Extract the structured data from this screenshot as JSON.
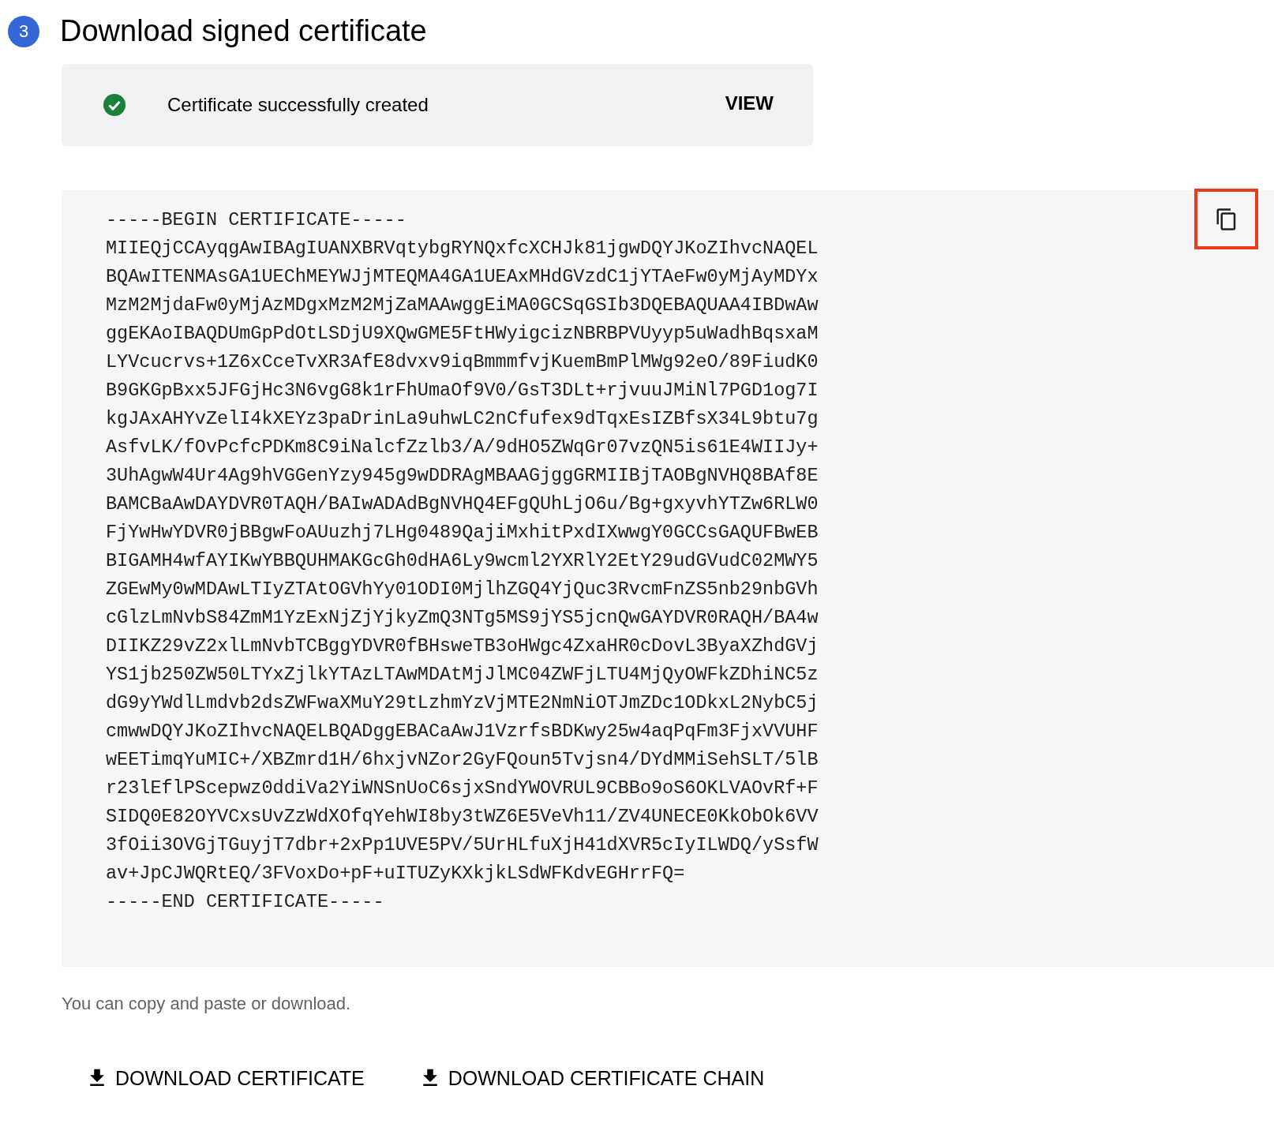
{
  "step": {
    "number": "3",
    "title": "Download signed certificate"
  },
  "banner": {
    "message": "Certificate successfully created",
    "action": "VIEW"
  },
  "certificate": {
    "copy_button": {
      "highlighted": true
    },
    "lines": [
      "-----BEGIN CERTIFICATE-----",
      "MIIEQjCCAyqgAwIBAgIUANXBRVqtybgRYNQxfcXCHJk81jgwDQYJKoZIhvcNAQEL",
      "BQAwITENMAsGA1UEChMEYWJjMTEQMA4GA1UEAxMHdGVzdC1jYTAeFw0yMjAyMDYx",
      "MzM2MjdaFw0yMjAzMDgxMzM2MjZaMAAwggEiMA0GCSqGSIb3DQEBAQUAA4IBDwAw",
      "ggEKAoIBAQDUmGpPdOtLSDjU9XQwGME5FtHWyigcizNBRBPVUyyp5uWadhBqsxaM",
      "LYVcucrvs+1Z6xCceTvXR3AfE8dvxv9iqBmmmfvjKuemBmPlMWg92eO/89FiudK0",
      "B9GKGpBxx5JFGjHc3N6vgG8k1rFhUmaOf9V0/GsT3DLt+rjvuuJMiNl7PGD1og7I",
      "kgJAxAHYvZelI4kXEYz3paDrinLa9uhwLC2nCfufex9dTqxEsIZBfsX34L9btu7g",
      "AsfvLK/fOvPcfcPDKm8C9iNalcfZzlb3/A/9dHO5ZWqGr07vzQN5is61E4WIIJy+",
      "3UhAgwW4Ur4Ag9hVGGenYzy945g9wDDRAgMBAAGjggGRMIIBjTAOBgNVHQ8BAf8E",
      "BAMCBaAwDAYDVR0TAQH/BAIwADAdBgNVHQ4EFgQUhLjO6u/Bg+gxyvhYTZw6RLW0",
      "FjYwHwYDVR0jBBgwFoAUuzhj7LHg0489QajiMxhitPxdIXwwgY0GCCsGAQUFBwEB",
      "BIGAMH4wfAYIKwYBBQUHMAKGcGh0dHA6Ly9wcml2YXRlY2EtY29udGVudC02MWY5",
      "ZGEwMy0wMDAwLTIyZTAtOGVhYy01ODI0MjlhZGQ4YjQuc3RvcmFnZS5nb29nbGVh",
      "cGlzLmNvbS84ZmM1YzExNjZjYjkyZmQ3NTg5MS9jYS5jcnQwGAYDVR0RAQH/BA4w",
      "DIIKZ29vZ2xlLmNvbTCBggYDVR0fBHsweTB3oHWgc4ZxaHR0cDovL3ByaXZhdGVj",
      "YS1jb250ZW50LTYxZjlkYTAzLTAwMDAtMjJlMC04ZWFjLTU4MjQyOWFkZDhiNC5z",
      "dG9yYWdlLmdvb2dsZWFwaXMuY29tLzhmYzVjMTE2NmNiOTJmZDc1ODkxL2NybC5j",
      "cmwwDQYJKoZIhvcNAQELBQADggEBACaAwJ1VzrfsBDKwy25w4aqPqFm3FjxVVUHF",
      "wEETimqYuMIC+/XBZmrd1H/6hxjvNZor2GyFQoun5Tvjsn4/DYdMMiSehSLT/5lB",
      "r23lEflPScepwz0ddiVa2YiWNSnUoC6sjxSndYWOVRUL9CBBo9oS6OKLVAOvRf+F",
      "SIDQ0E82OYVCxsUvZzWdXOfqYehWI8by3tWZ6E5VeVh11/ZV4UNECE0KkObOk6VV",
      "3fOii3OVGjTGuyjT7dbr+2xPp1UVE5PV/5UrHLfuXjH41dXVR5cIyILWDQ/ySsfW",
      "av+JpCJWQRtEQ/3FVoxDo+pF+uITUZyKXkjkLSdWFKdvEGHrrFQ=",
      "-----END CERTIFICATE-----"
    ]
  },
  "hint": "You can copy and paste or download.",
  "buttons": [
    {
      "label": "DOWNLOAD CERTIFICATE"
    },
    {
      "label": "DOWNLOAD CERTIFICATE CHAIN"
    }
  ]
}
